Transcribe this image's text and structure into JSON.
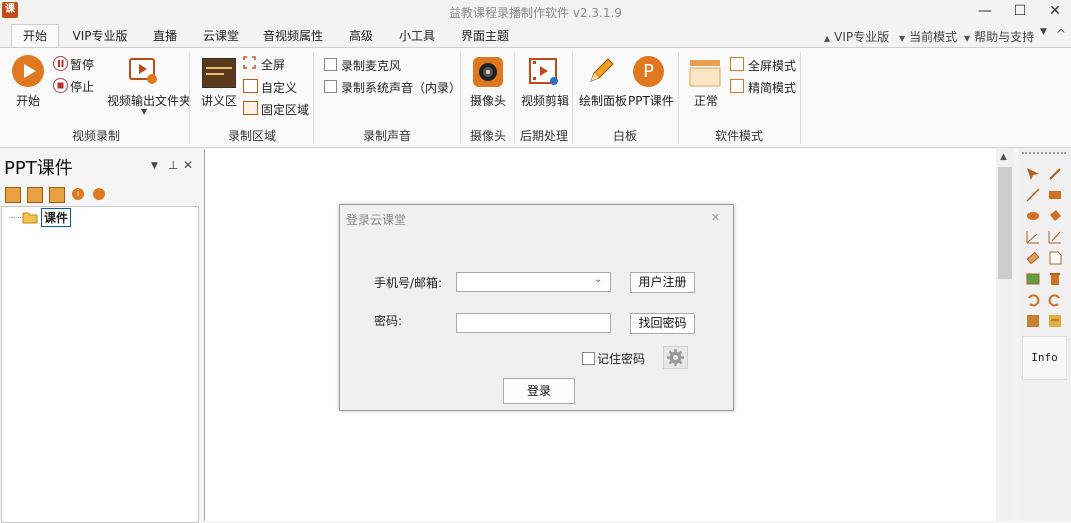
{
  "window": {
    "title": "益教课程录播制作软件 v2.3.1.9",
    "icon_glyph": "课",
    "min": "—",
    "max": "☐",
    "close": "✕"
  },
  "menu": {
    "tabs": [
      "开始",
      "VIP专业版",
      "直播",
      "云课堂",
      "音视频属性",
      "高级",
      "小工具",
      "界面主题"
    ],
    "right": [
      "VIP专业版",
      "当前模式",
      "帮助与支持"
    ]
  },
  "ribbon": {
    "groups": {
      "video_record": {
        "label": "视频录制",
        "start": "开始",
        "pause": "暂停",
        "stop": "停止",
        "output_folder": "视频输出文件夹"
      },
      "record_area": {
        "label": "录制区域",
        "lecture": "讲义区",
        "fullscreen": "全屏",
        "custom": "自定义",
        "fixed": "固定区域"
      },
      "record_sound": {
        "label": "录制声音",
        "mic": "录制麦克风",
        "system": "录制系统声音（内录）"
      },
      "camera": {
        "label": "摄像头",
        "camera": "摄像头"
      },
      "post": {
        "label": "后期处理",
        "edit": "视频剪辑"
      },
      "whiteboard": {
        "label": "白板",
        "draw": "绘制面板",
        "ppt": "PPT课件"
      },
      "mode": {
        "label": "软件模式",
        "normal": "正常",
        "full": "全屏模式",
        "simple": "精简模式"
      }
    }
  },
  "left_panel": {
    "title": "PPT课件",
    "tree_root": "课件",
    "pin": "ᵖ",
    "close": "✕"
  },
  "right_toolbar": {
    "info_label": "Info"
  },
  "dialog": {
    "title": "登录云课堂",
    "close": "✕",
    "phone_label": "手机号/邮箱:",
    "phone_value": "",
    "password_label": "密码:",
    "password_value": "",
    "register_button": "用户注册",
    "recover_button": "找回密码",
    "remember_label": "记住密码",
    "login_button": "登录"
  },
  "colors": {
    "accent_orange": "#e0781f",
    "dialog_bg": "#f0f0f0",
    "ribbon_bg": "#fafafa"
  }
}
